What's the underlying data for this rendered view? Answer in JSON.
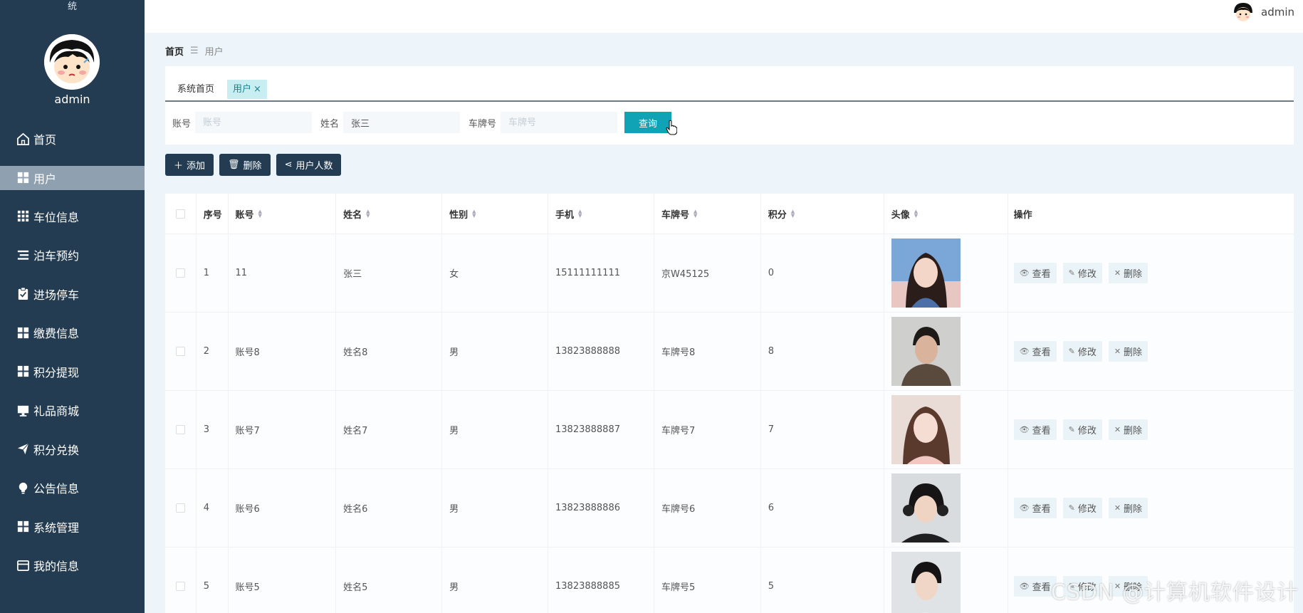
{
  "sidebar": {
    "system_title": "统",
    "username": "admin",
    "items": [
      {
        "label": "首页",
        "icon": "home-icon"
      },
      {
        "label": "用户",
        "icon": "grid-icon"
      },
      {
        "label": "车位信息",
        "icon": "grid-icon"
      },
      {
        "label": "泊车预约",
        "icon": "list-icon"
      },
      {
        "label": "进场停车",
        "icon": "clipboard-icon"
      },
      {
        "label": "缴费信息",
        "icon": "grid-icon"
      },
      {
        "label": "积分提现",
        "icon": "grid-icon"
      },
      {
        "label": "礼品商城",
        "icon": "monitor-icon"
      },
      {
        "label": "积分兑换",
        "icon": "paper-plane-icon"
      },
      {
        "label": "公告信息",
        "icon": "bulb-icon"
      },
      {
        "label": "系统管理",
        "icon": "grid-icon"
      },
      {
        "label": "我的信息",
        "icon": "card-icon"
      }
    ],
    "active_index": 1
  },
  "topbar": {
    "username": "admin"
  },
  "breadcrumb": {
    "home": "首页",
    "current": "用户"
  },
  "tabs": [
    {
      "label": "系统首页"
    },
    {
      "label": "用户",
      "close": "×"
    }
  ],
  "search": {
    "account_label": "账号",
    "account_placeholder": "账号",
    "account_value": "",
    "name_label": "姓名",
    "name_value": "张三",
    "plate_label": "车牌号",
    "plate_placeholder": "车牌号",
    "plate_value": "",
    "button": "查询"
  },
  "actions": {
    "add": "添加",
    "delete": "删除",
    "count": "用户人数"
  },
  "table": {
    "headers": [
      "序号",
      "账号",
      "姓名",
      "性别",
      "手机",
      "车牌号",
      "积分",
      "头像",
      "操作"
    ],
    "op_labels": {
      "view": "查看",
      "edit": "修改",
      "delete": "删除"
    },
    "rows": [
      {
        "idx": "1",
        "account": "11",
        "name": "张三",
        "gender": "女",
        "phone": "15111111111",
        "plate": "京W45125",
        "points": "0"
      },
      {
        "idx": "2",
        "account": "账号8",
        "name": "姓名8",
        "gender": "男",
        "phone": "13823888888",
        "plate": "车牌号8",
        "points": "8"
      },
      {
        "idx": "3",
        "account": "账号7",
        "name": "姓名7",
        "gender": "男",
        "phone": "13823888887",
        "plate": "车牌号7",
        "points": "7"
      },
      {
        "idx": "4",
        "account": "账号6",
        "name": "姓名6",
        "gender": "男",
        "phone": "13823888886",
        "plate": "车牌号6",
        "points": "6"
      },
      {
        "idx": "5",
        "account": "账号5",
        "name": "姓名5",
        "gender": "男",
        "phone": "13823888885",
        "plate": "车牌号5",
        "points": "5"
      }
    ]
  },
  "watermark": "CSDN @计算机软件设计",
  "colors": {
    "sidebar": "#243c52",
    "accent": "#0fa3b5",
    "active_menu": "#8fa1b1"
  }
}
